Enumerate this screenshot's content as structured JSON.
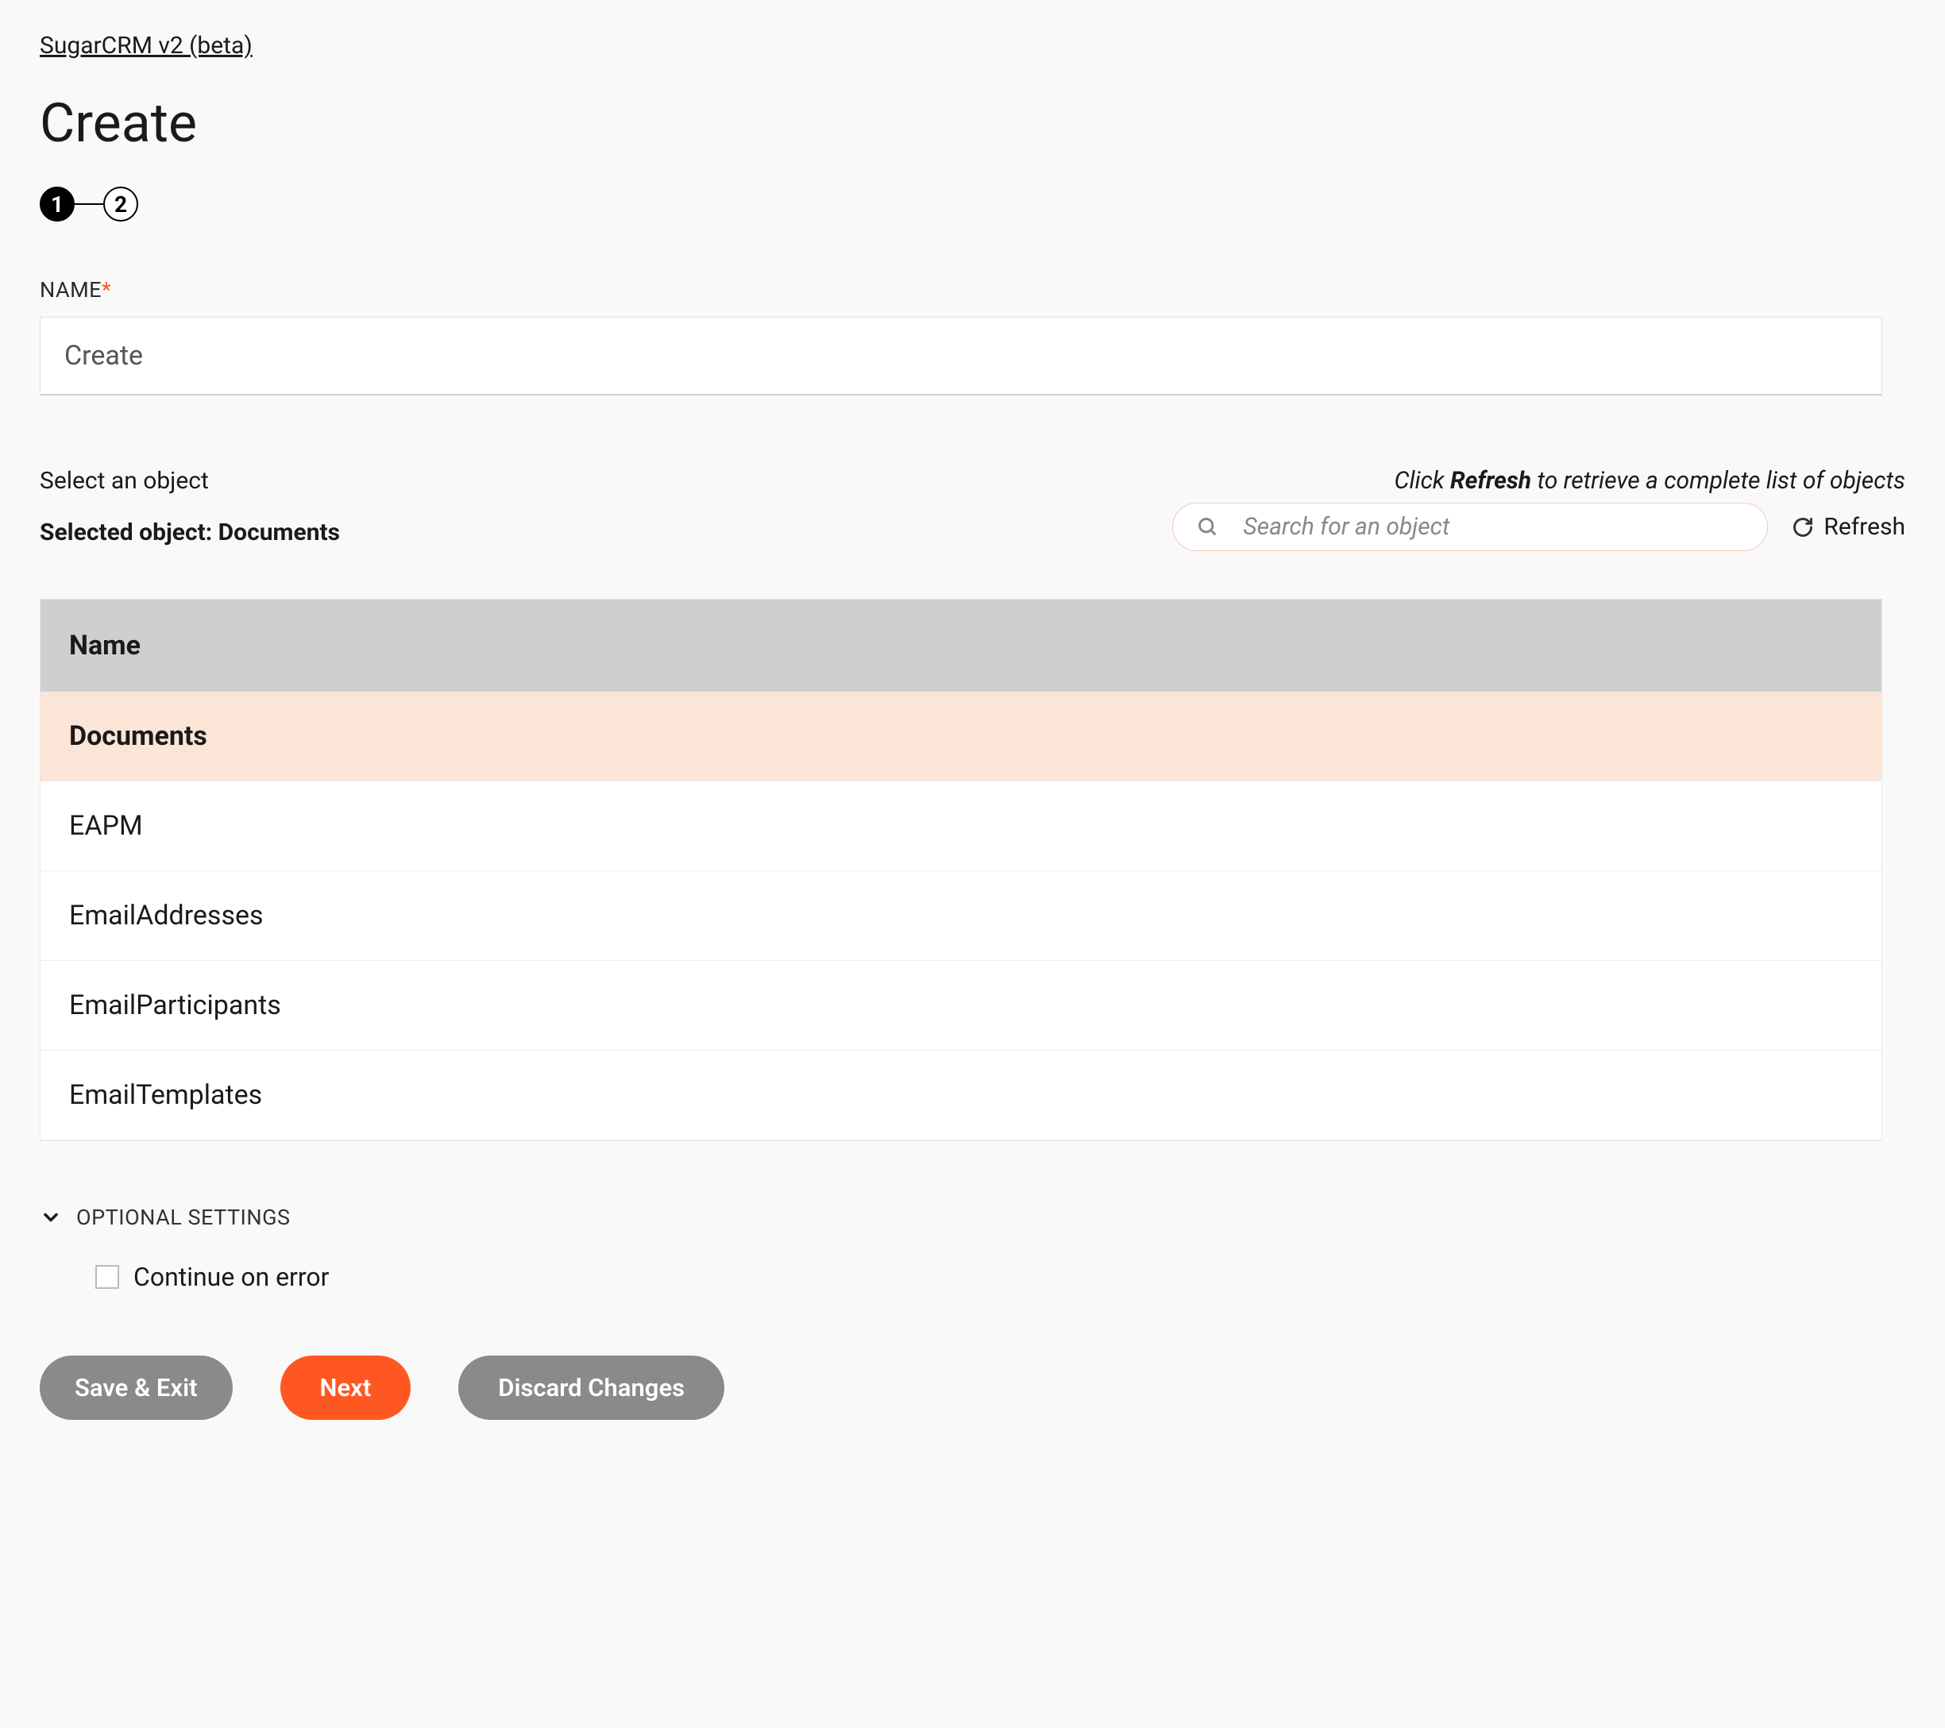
{
  "breadcrumb": "SugarCRM v2 (beta)",
  "page_title": "Create",
  "stepper": {
    "step1": "1",
    "step2": "2"
  },
  "name_field": {
    "label": "NAME",
    "value": "Create"
  },
  "object_section": {
    "select_label": "Select an object",
    "selected_prefix": "Selected object: ",
    "selected_value": "Documents",
    "hint_prefix": "Click ",
    "hint_bold": "Refresh",
    "hint_suffix": " to retrieve a complete list of objects",
    "search_placeholder": "Search for an object",
    "refresh_label": "Refresh"
  },
  "table": {
    "header": "Name",
    "rows": [
      {
        "label": "Documents",
        "selected": true
      },
      {
        "label": "EAPM",
        "selected": false
      },
      {
        "label": "EmailAddresses",
        "selected": false
      },
      {
        "label": "EmailParticipants",
        "selected": false
      },
      {
        "label": "EmailTemplates",
        "selected": false
      }
    ]
  },
  "optional": {
    "header": "OPTIONAL SETTINGS",
    "continue_label": "Continue on error"
  },
  "buttons": {
    "save_exit": "Save & Exit",
    "next": "Next",
    "discard": "Discard Changes"
  }
}
